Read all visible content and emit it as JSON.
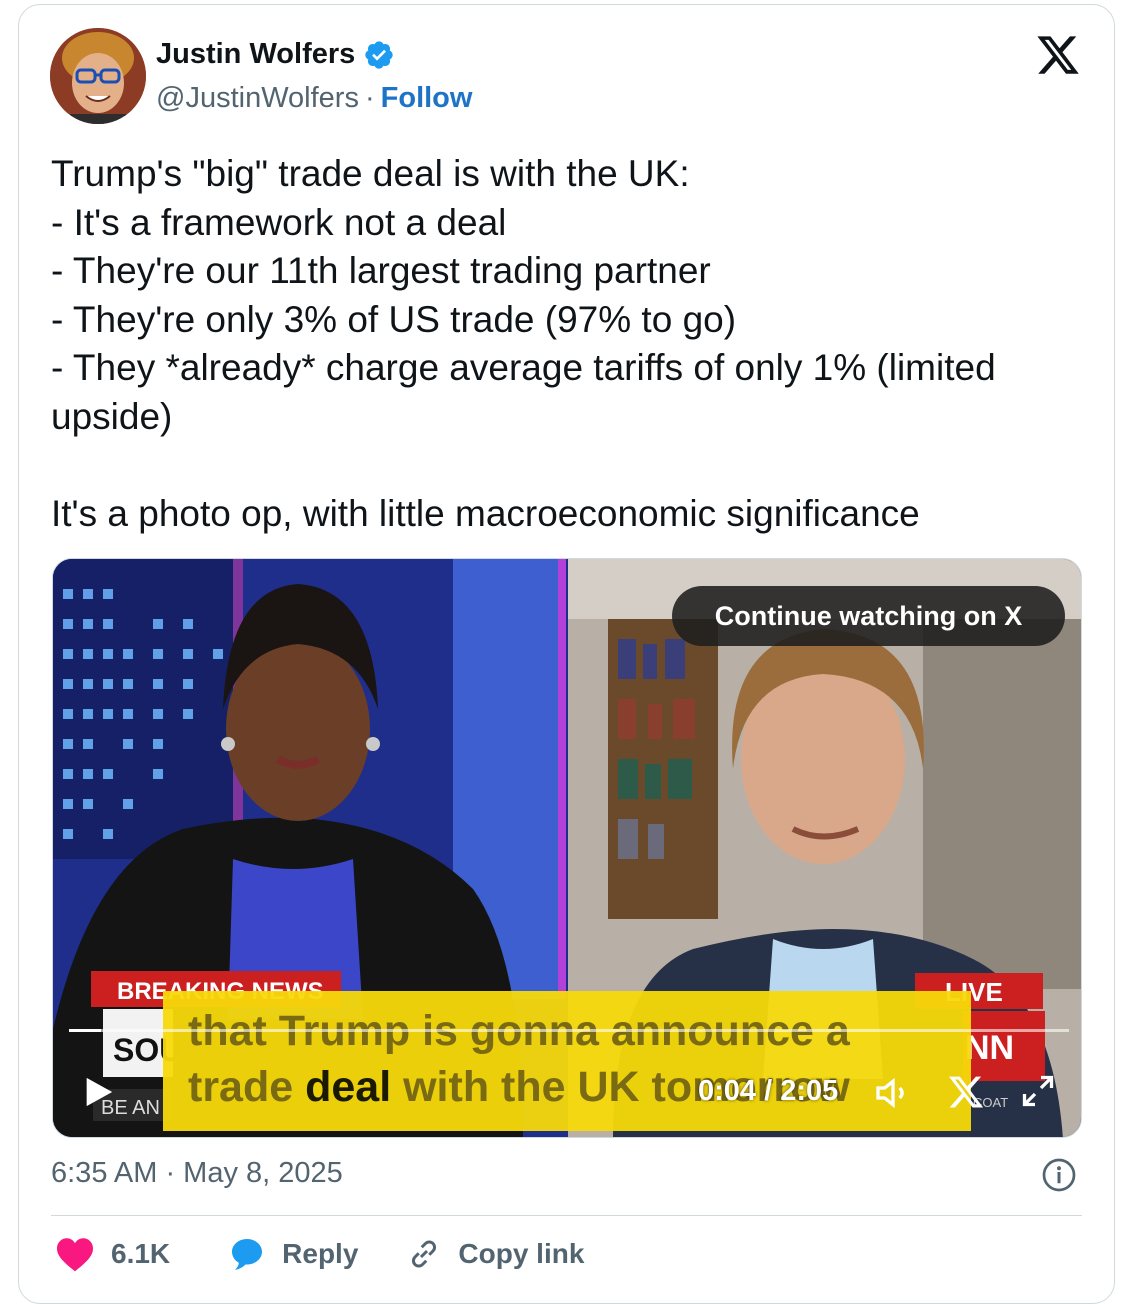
{
  "author": {
    "name": "Justin Wolfers",
    "handle": "@JustinWolfers",
    "separator": "·",
    "follow_label": "Follow"
  },
  "tweet": {
    "text": "Trump's \"big\" trade deal is with the UK:\n- It's a framework not a deal\n- They're our 11th largest trading partner\n- They're only 3% of US trade (97% to go)\n- They *already* charge average tariffs of only 1% (limited upside)\n\nIt's a photo op, with little macroeconomic significance"
  },
  "media": {
    "continue_label": "Continue watching on X",
    "caption_line1": "that Trump is gonna announce a",
    "caption_line2_pre": "trade ",
    "caption_line2_bold": "deal",
    "caption_line2_post": " with the UK tomorrow",
    "chyron_left": "BREAKING NEWS",
    "chyron_left2": "SOU",
    "chyron_left3": "BE AN",
    "chyron_right": "LIVE",
    "chyron_right2": "COAT",
    "time_display": "0:04 / 2:05",
    "progress_fraction": 0.032
  },
  "meta": {
    "timestamp": "6:35 AM · May 8, 2025"
  },
  "actions": {
    "like_count": "6.1K",
    "reply_label": "Reply",
    "copy_label": "Copy link"
  },
  "colors": {
    "accent": "#1d74c6",
    "verified": "#1d9bf0",
    "like": "#f91880",
    "caption_bg": "#f6d90a"
  }
}
